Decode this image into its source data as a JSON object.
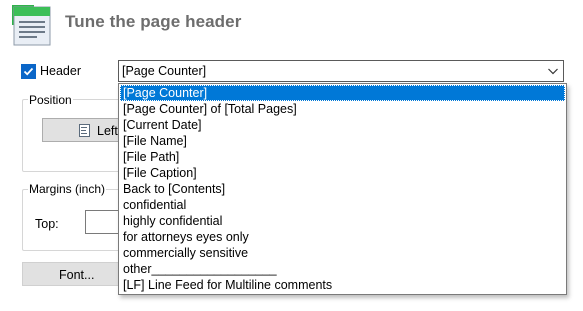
{
  "window": {
    "title": "Tune the page header"
  },
  "header_checkbox": {
    "label": "Header",
    "checked": true
  },
  "combo": {
    "value": "[Page Counter]"
  },
  "position_group": {
    "legend": "Position",
    "left_button_label": "Left"
  },
  "margins_group": {
    "legend": "Margins (inch)",
    "top_label": "Top:",
    "top_value": ""
  },
  "font_button": {
    "label": "Font..."
  },
  "dropdown": {
    "selected_index": 0,
    "items": [
      "[Page Counter]",
      "[Page Counter] of [Total Pages]",
      "[Current Date]",
      "[File Name]",
      "[File Path]",
      "[File Caption]",
      "Back to [Contents]",
      "confidential",
      "highly confidential",
      "for attorneys eyes only",
      "commercially sensitive",
      "other__________________",
      "[LF] Line Feed for Multiline comments"
    ]
  },
  "colors": {
    "accent": "#0078d7",
    "title": "#6d6d6d",
    "checkbox": "#0a66c8"
  },
  "icons": {
    "app": "page-header-icon",
    "combo": "chevron-down-icon",
    "align": "align-left-icon",
    "check": "checkmark-icon"
  }
}
